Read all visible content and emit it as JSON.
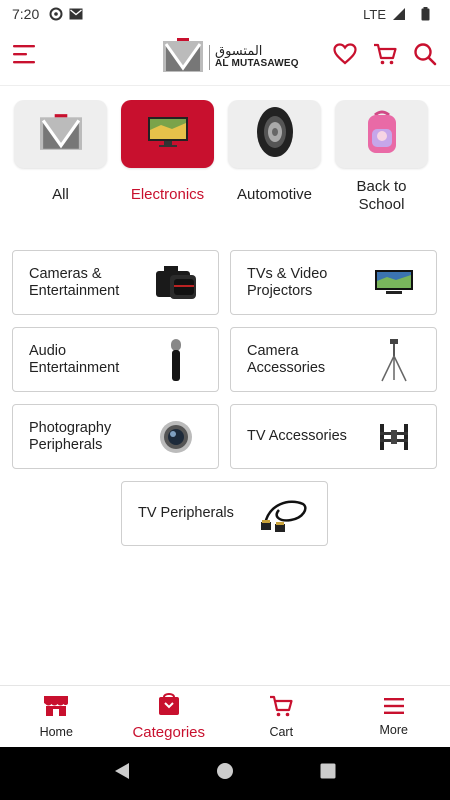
{
  "status_bar": {
    "time": "7:20",
    "network": "LTE",
    "icons": [
      "data-saver-icon",
      "gmail-icon",
      "signal-icon",
      "battery-icon"
    ]
  },
  "header": {
    "logo_arabic": "المتسوق",
    "logo_english": "AL MUTASAWEQ",
    "icons": [
      "menu-icon",
      "heart-icon",
      "cart-icon",
      "search-icon"
    ],
    "accent": "#c8102e"
  },
  "categories": [
    {
      "label": "All",
      "icon": "logo-icon",
      "active": false
    },
    {
      "label": "Electronics",
      "icon": "tv-icon",
      "active": true
    },
    {
      "label": "Automotive",
      "icon": "tire-icon",
      "active": false
    },
    {
      "label": "Back to School",
      "icon": "backpack-icon",
      "active": false
    }
  ],
  "subcategories": [
    {
      "label_1": "Cameras &",
      "label_2": "Entertainment",
      "icon": "camera-icon"
    },
    {
      "label_1": "TVs & Video",
      "label_2": "Projectors",
      "icon": "tv-icon"
    },
    {
      "label_1": "Audio",
      "label_2": "Entertainment",
      "icon": "microphone-icon"
    },
    {
      "label_1": "Camera",
      "label_2": "Accessories",
      "icon": "tripod-icon"
    },
    {
      "label_1": "Photography",
      "label_2": "Peripherals",
      "icon": "lens-icon"
    },
    {
      "label_1": "TV Accessories",
      "label_2": "",
      "icon": "tv-mount-icon"
    },
    {
      "label_1": "TV Peripherals",
      "label_2": "",
      "icon": "hdmi-cable-icon"
    }
  ],
  "bottom_nav": [
    {
      "label": "Home",
      "icon": "store-icon",
      "active": false
    },
    {
      "label": "Categories",
      "icon": "categories-bag-icon",
      "active": true
    },
    {
      "label": "Cart",
      "icon": "cart-icon",
      "active": false
    },
    {
      "label": "More",
      "icon": "more-menu-icon",
      "active": false
    }
  ],
  "colors": {
    "accent": "#c8102e",
    "tile": "#eeeeee",
    "border": "#cfcfcf"
  }
}
